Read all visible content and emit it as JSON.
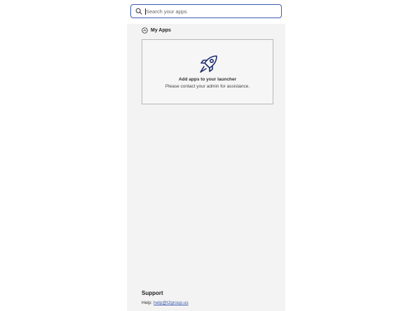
{
  "search": {
    "placeholder": "Search your apps",
    "value": ""
  },
  "section": {
    "title": "My Apps",
    "icon": "collapse-up-icon"
  },
  "empty_state": {
    "icon": "rocket-icon",
    "headline": "Add apps to your launcher",
    "message": "Please contact your admin for assistance."
  },
  "support": {
    "title": "Support",
    "help_label": "Help:",
    "help_email": "help@t2group.us"
  },
  "colors": {
    "accent": "#3b5bb3",
    "panel": "#f3f3f3",
    "icon": "#1e2f6e"
  }
}
